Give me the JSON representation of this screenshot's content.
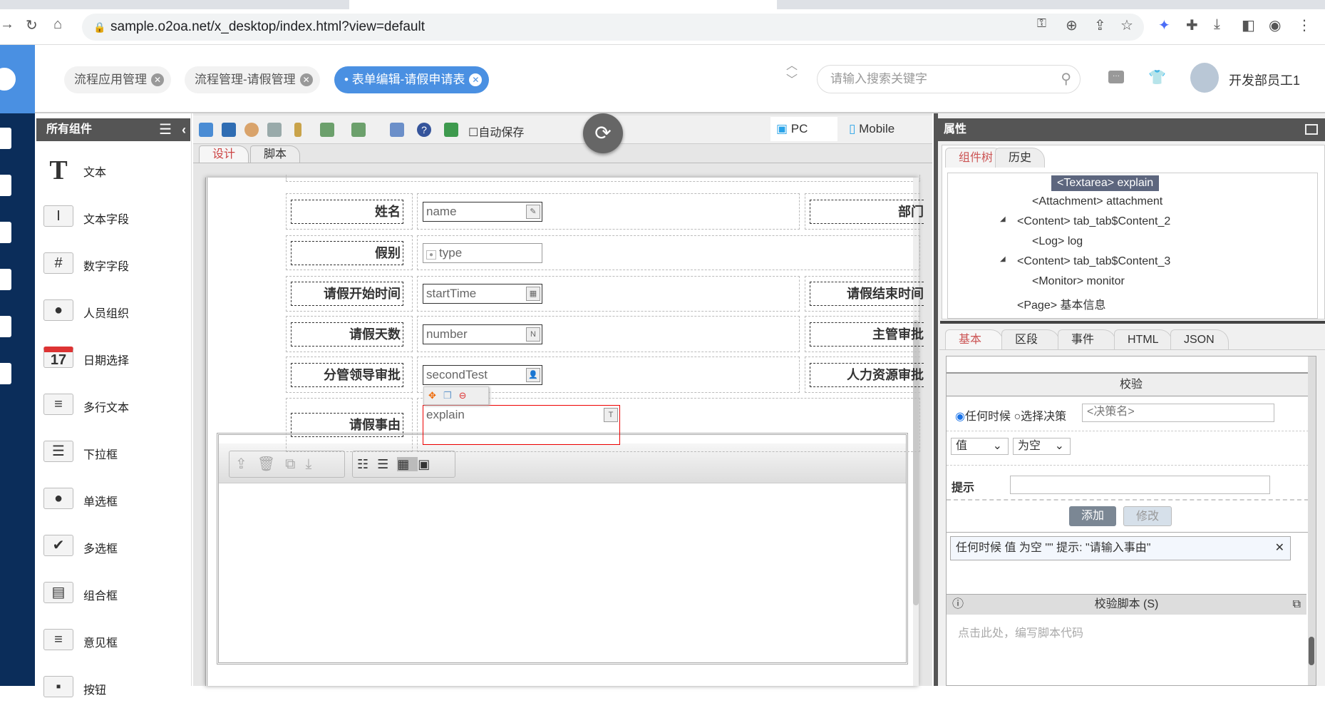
{
  "browser": {
    "url": "sample.o2oa.net/x_desktop/index.html?view=default"
  },
  "header": {
    "tabs": [
      {
        "label": "流程应用管理"
      },
      {
        "label": "流程管理-请假管理"
      },
      {
        "label": "表单编辑-请假申请表",
        "active": true
      }
    ],
    "search_placeholder": "请输入搜索关键字",
    "user": "开发部员工1"
  },
  "components": {
    "title": "所有组件",
    "items": [
      {
        "label": "文本",
        "icon": "T"
      },
      {
        "label": "文本字段",
        "icon": "I"
      },
      {
        "label": "数字字段",
        "icon": "#"
      },
      {
        "label": "人员组织",
        "icon": "●"
      },
      {
        "label": "日期选择",
        "icon": "17"
      },
      {
        "label": "多行文本",
        "icon": "≡"
      },
      {
        "label": "下拉框",
        "icon": "☰"
      },
      {
        "label": "单选框",
        "icon": "●"
      },
      {
        "label": "多选框",
        "icon": "✔"
      },
      {
        "label": "组合框",
        "icon": "▤"
      },
      {
        "label": "意见框",
        "icon": "≡"
      },
      {
        "label": "按钮",
        "icon": "▪"
      }
    ]
  },
  "toolbar": {
    "autosave": "自动保存",
    "pc": "PC",
    "mobile": "Mobile",
    "tabs": [
      "设计",
      "脚本"
    ]
  },
  "form": {
    "rows": [
      {
        "label": "姓名",
        "field": "name",
        "field_icon": "✎",
        "right": "部门"
      },
      {
        "label": "假别",
        "field": "type",
        "field_icon": "•"
      },
      {
        "label": "请假开始时间",
        "field": "startTime",
        "field_icon": "▦",
        "right": "请假结束时间"
      },
      {
        "label": "请假天数",
        "field": "number",
        "field_icon": "N",
        "right": "主管审批"
      },
      {
        "label": "分管领导审批",
        "field": "secondTest",
        "field_icon": "👤",
        "right": "人力资源审批"
      },
      {
        "label": "请假事由",
        "field": "explain",
        "field_icon": "T"
      }
    ]
  },
  "props": {
    "title": "属性",
    "tree_tabs": [
      "组件树",
      "历史"
    ],
    "tree": [
      {
        "text": "<Textarea> explain",
        "selected": true
      },
      {
        "text": "<Attachment> attachment"
      },
      {
        "text": "<Content> tab_tab$Content_2",
        "toggle": "◢"
      },
      {
        "text": "<Log> log"
      },
      {
        "text": "<Content> tab_tab$Content_3",
        "toggle": "◢"
      },
      {
        "text": "<Monitor> monitor"
      },
      {
        "text": "<Page> 基本信息"
      }
    ],
    "tabs": [
      "基本",
      "区段",
      "事件",
      "HTML",
      "JSON"
    ],
    "validation": {
      "title": "校验",
      "radio_any": "任何时候",
      "radio_decision": "选择决策",
      "decision_placeholder": "<决策名>",
      "select_value": "值",
      "select_cond": "为空",
      "hint_label": "提示",
      "add": "添加",
      "modify": "修改",
      "rule": "任何时候 值 为空 \"\" 提示: \"请输入事由\"",
      "script_title": "校验脚本 (S)",
      "script_placeholder": "点击此处，编写脚本代码"
    }
  }
}
